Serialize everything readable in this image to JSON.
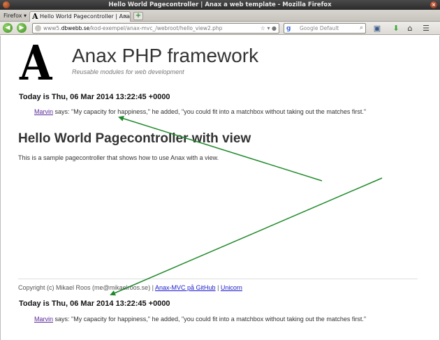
{
  "window": {
    "title": "Hello World Pagecontroller | Anax a web template - Mozilla Firefox",
    "close_glyph": "×"
  },
  "tabs": {
    "firefox_menu": "Firefox",
    "active_tab_favicon": "A",
    "active_tab": "Hello World Pagecontroller | Ana...",
    "close_glyph": "×",
    "new_tab_glyph": "+"
  },
  "navbar": {
    "back_glyph": "◀",
    "forward_glyph": "▶",
    "url_prefix": "www5.",
    "url_host": "dbwebb.se",
    "url_path": "/kod-exempel/anax-mvc_/webroot/hello_view2.php",
    "url_icons": "☆ ▾ ●",
    "search_engine_glyph": "g",
    "search_placeholder": "Google Default",
    "search_glyph": "⌕",
    "tools": [
      "▣",
      "⬇",
      "⌂",
      "☰"
    ]
  },
  "page": {
    "logo_letter": "A",
    "site_title": "Anax PHP framework",
    "site_slogan": "Reusable modules for web development",
    "today_header": "Today is Thu, 06 Mar 2014 13:22:45 +0000",
    "quote_author": "Marvin",
    "quote_text": " says: \"My capacity for happiness,\" he added, \"you could fit into a matchbox without taking out the matches first.\"",
    "page_title": "Hello World Pagecontroller with view",
    "page_text": "This is a sample pagecontroller that shows how to use Anax with a view.",
    "footer_text": "Copyright (c) Mikael Roos (me@mikaelroos.se) | ",
    "footer_link_github": "Anax-MVC på GitHub",
    "footer_sep": " | ",
    "footer_link_unicorn": "Unicorn",
    "today_footer": "Today is Thu, 06 Mar 2014 13:22:45 +0000",
    "quote_author_footer": "Marvin",
    "quote_text_footer": " says: \"My capacity for happiness,\" he added, \"you could fit into a matchbox without taking out the matches first.\""
  },
  "colors": {
    "annotation_arrow": "#1f8a2a",
    "link": "#1a1acc",
    "visited_link": "#5a2a9a"
  }
}
